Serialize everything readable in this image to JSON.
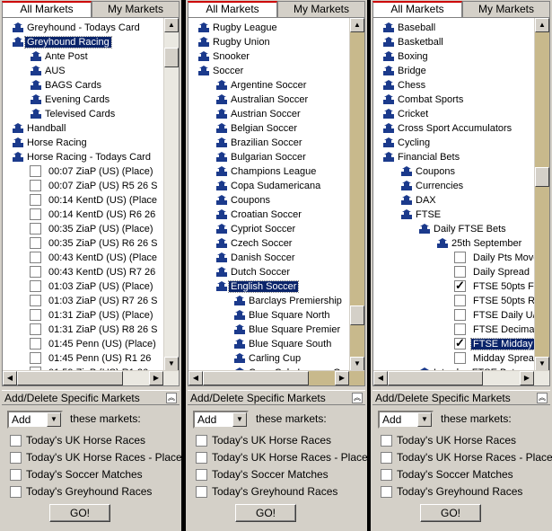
{
  "colors": {
    "arrow": "#1b3a8c",
    "selection": "#0a246a",
    "active_tab_top": "#cc0000",
    "scroll_track_tan": "#c8b98c"
  },
  "panels": [
    {
      "tabs": {
        "all": "All Markets",
        "my": "My Markets"
      },
      "tree": [
        {
          "type": "arrow",
          "level": 0,
          "label": "Greyhound - Todays Card"
        },
        {
          "type": "arrow",
          "level": 0,
          "label": "Greyhound Racing",
          "selected": true
        },
        {
          "type": "arrow",
          "level": 1,
          "label": "Ante Post"
        },
        {
          "type": "arrow",
          "level": 1,
          "label": "AUS"
        },
        {
          "type": "arrow",
          "level": 1,
          "label": "BAGS Cards"
        },
        {
          "type": "arrow",
          "level": 1,
          "label": "Evening Cards"
        },
        {
          "type": "arrow",
          "level": 1,
          "label": "Televised Cards"
        },
        {
          "type": "arrow",
          "level": 0,
          "label": "Handball"
        },
        {
          "type": "arrow",
          "level": 0,
          "label": "Horse Racing"
        },
        {
          "type": "arrow",
          "level": 0,
          "label": "Horse Racing - Todays Card"
        },
        {
          "type": "check",
          "level": 1,
          "label": "00:07 ZiaP (US)  (Place)"
        },
        {
          "type": "check",
          "level": 1,
          "label": "00:07 ZiaP (US)  R5 26 S"
        },
        {
          "type": "check",
          "level": 1,
          "label": "00:14 KentD (US)  (Place"
        },
        {
          "type": "check",
          "level": 1,
          "label": "00:14 KentD (US)  R6 26"
        },
        {
          "type": "check",
          "level": 1,
          "label": "00:35 ZiaP (US)  (Place)"
        },
        {
          "type": "check",
          "level": 1,
          "label": "00:35 ZiaP (US)  R6 26 S"
        },
        {
          "type": "check",
          "level": 1,
          "label": "00:43 KentD (US)  (Place"
        },
        {
          "type": "check",
          "level": 1,
          "label": "00:43 KentD (US)  R7 26"
        },
        {
          "type": "check",
          "level": 1,
          "label": "01:03 ZiaP (US)  (Place)"
        },
        {
          "type": "check",
          "level": 1,
          "label": "01:03 ZiaP (US)  R7 26 S"
        },
        {
          "type": "check",
          "level": 1,
          "label": "01:31 ZiaP (US)  (Place)"
        },
        {
          "type": "check",
          "level": 1,
          "label": "01:31 ZiaP (US)  R8 26 S"
        },
        {
          "type": "check",
          "level": 1,
          "label": "01:45 Penn (US)  (Place)"
        },
        {
          "type": "check",
          "level": 1,
          "label": "01:45 Penn (US)  R1 26"
        },
        {
          "type": "check",
          "level": 1,
          "label": "01:59 ZiaP (US)  R1 26"
        }
      ],
      "section_title": "Add/Delete Specific Markets",
      "add_select": "Add",
      "add_text": "these markets:",
      "options": [
        "Today's UK Horse Races",
        "Today's UK Horse Races - Place",
        "Today's Soccer Matches",
        "Today's Greyhound Races"
      ],
      "go": "GO!"
    },
    {
      "tabs": {
        "all": "All Markets",
        "my": "My Markets"
      },
      "tree": [
        {
          "type": "arrow",
          "level": 0,
          "label": "Rugby League"
        },
        {
          "type": "arrow",
          "level": 0,
          "label": "Rugby Union"
        },
        {
          "type": "arrow",
          "level": 0,
          "label": "Snooker"
        },
        {
          "type": "arrow",
          "level": 0,
          "label": "Soccer"
        },
        {
          "type": "arrow",
          "level": 1,
          "label": "Argentine Soccer"
        },
        {
          "type": "arrow",
          "level": 1,
          "label": "Australian Soccer"
        },
        {
          "type": "arrow",
          "level": 1,
          "label": "Austrian Soccer"
        },
        {
          "type": "arrow",
          "level": 1,
          "label": "Belgian Soccer"
        },
        {
          "type": "arrow",
          "level": 1,
          "label": "Brazilian Soccer"
        },
        {
          "type": "arrow",
          "level": 1,
          "label": "Bulgarian Soccer"
        },
        {
          "type": "arrow",
          "level": 1,
          "label": "Champions League"
        },
        {
          "type": "arrow",
          "level": 1,
          "label": "Copa Sudamericana"
        },
        {
          "type": "arrow",
          "level": 1,
          "label": "Coupons"
        },
        {
          "type": "arrow",
          "level": 1,
          "label": "Croatian Soccer"
        },
        {
          "type": "arrow",
          "level": 1,
          "label": "Cypriot Soccer"
        },
        {
          "type": "arrow",
          "level": 1,
          "label": "Czech Soccer"
        },
        {
          "type": "arrow",
          "level": 1,
          "label": "Danish Soccer"
        },
        {
          "type": "arrow",
          "level": 1,
          "label": "Dutch Soccer"
        },
        {
          "type": "arrow",
          "level": 1,
          "label": "English Soccer",
          "selected": true
        },
        {
          "type": "arrow",
          "level": 2,
          "label": "Barclays Premiership"
        },
        {
          "type": "arrow",
          "level": 2,
          "label": "Blue Square North"
        },
        {
          "type": "arrow",
          "level": 2,
          "label": "Blue Square Premier"
        },
        {
          "type": "arrow",
          "level": 2,
          "label": "Blue Square South"
        },
        {
          "type": "arrow",
          "level": 2,
          "label": "Carling Cup"
        },
        {
          "type": "arrow",
          "level": 2,
          "label": "Coca Cola League O"
        }
      ],
      "section_title": "Add/Delete Specific Markets",
      "add_select": "Add",
      "add_text": "these markets:",
      "options": [
        "Today's UK Horse Races",
        "Today's UK Horse Races - Place",
        "Today's Soccer Matches",
        "Today's Greyhound Races"
      ],
      "go": "GO!"
    },
    {
      "tabs": {
        "all": "All Markets",
        "my": "My Markets"
      },
      "tree": [
        {
          "type": "arrow",
          "level": 0,
          "label": "Baseball"
        },
        {
          "type": "arrow",
          "level": 0,
          "label": "Basketball"
        },
        {
          "type": "arrow",
          "level": 0,
          "label": "Boxing"
        },
        {
          "type": "arrow",
          "level": 0,
          "label": "Bridge"
        },
        {
          "type": "arrow",
          "level": 0,
          "label": "Chess"
        },
        {
          "type": "arrow",
          "level": 0,
          "label": "Combat Sports"
        },
        {
          "type": "arrow",
          "level": 0,
          "label": "Cricket"
        },
        {
          "type": "arrow",
          "level": 0,
          "label": "Cross Sport Accumulators"
        },
        {
          "type": "arrow",
          "level": 0,
          "label": "Cycling"
        },
        {
          "type": "arrow",
          "level": 0,
          "label": "Financial Bets"
        },
        {
          "type": "arrow",
          "level": 1,
          "label": "Coupons"
        },
        {
          "type": "arrow",
          "level": 1,
          "label": "Currencies"
        },
        {
          "type": "arrow",
          "level": 1,
          "label": "DAX"
        },
        {
          "type": "arrow",
          "level": 1,
          "label": "FTSE"
        },
        {
          "type": "arrow",
          "level": 2,
          "label": "Daily FTSE Bets"
        },
        {
          "type": "arrow",
          "level": 3,
          "label": "25th September"
        },
        {
          "type": "check",
          "level": 4,
          "label": "Daily Pts Move"
        },
        {
          "type": "check",
          "level": 4,
          "label": "Daily Spread"
        },
        {
          "type": "check",
          "level": 4,
          "label": "FTSE 50pts Fa",
          "checked": true
        },
        {
          "type": "check",
          "level": 4,
          "label": "FTSE 50pts Ri"
        },
        {
          "type": "check",
          "level": 4,
          "label": "FTSE Daily U/"
        },
        {
          "type": "check",
          "level": 4,
          "label": "FTSE Decimal"
        },
        {
          "type": "check",
          "level": 4,
          "label": "FTSE Midday U",
          "checked": true,
          "selected": true
        },
        {
          "type": "check",
          "level": 4,
          "label": "Midday Spread"
        },
        {
          "type": "arrow",
          "level": 2,
          "label": "Intraday FTSE Bets"
        }
      ],
      "section_title": "Add/Delete Specific Markets",
      "add_select": "Add",
      "add_text": "these markets:",
      "options": [
        "Today's UK Horse Races",
        "Today's UK Horse Races - Place",
        "Today's Soccer Matches",
        "Today's Greyhound Races"
      ],
      "go": "GO!"
    }
  ]
}
